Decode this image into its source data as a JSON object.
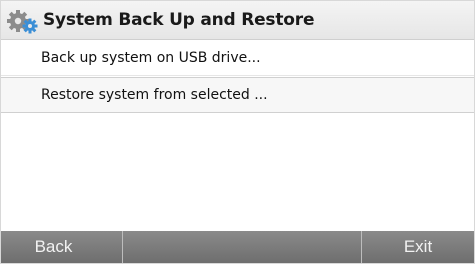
{
  "window": {
    "title": "System Back Up and Restore",
    "icon": "gears-icon"
  },
  "menu": {
    "items": [
      {
        "label": "Back up system on USB drive..."
      },
      {
        "label": "Restore system from selected ..."
      }
    ]
  },
  "footer": {
    "back_label": "Back",
    "exit_label": "Exit"
  },
  "colors": {
    "titlebar": "#eeeeee",
    "footer": "#7c7c7c",
    "footer_text": "#f2f2f2",
    "icon_blue": "#3b8fd6",
    "icon_gray": "#8c8c8c"
  }
}
